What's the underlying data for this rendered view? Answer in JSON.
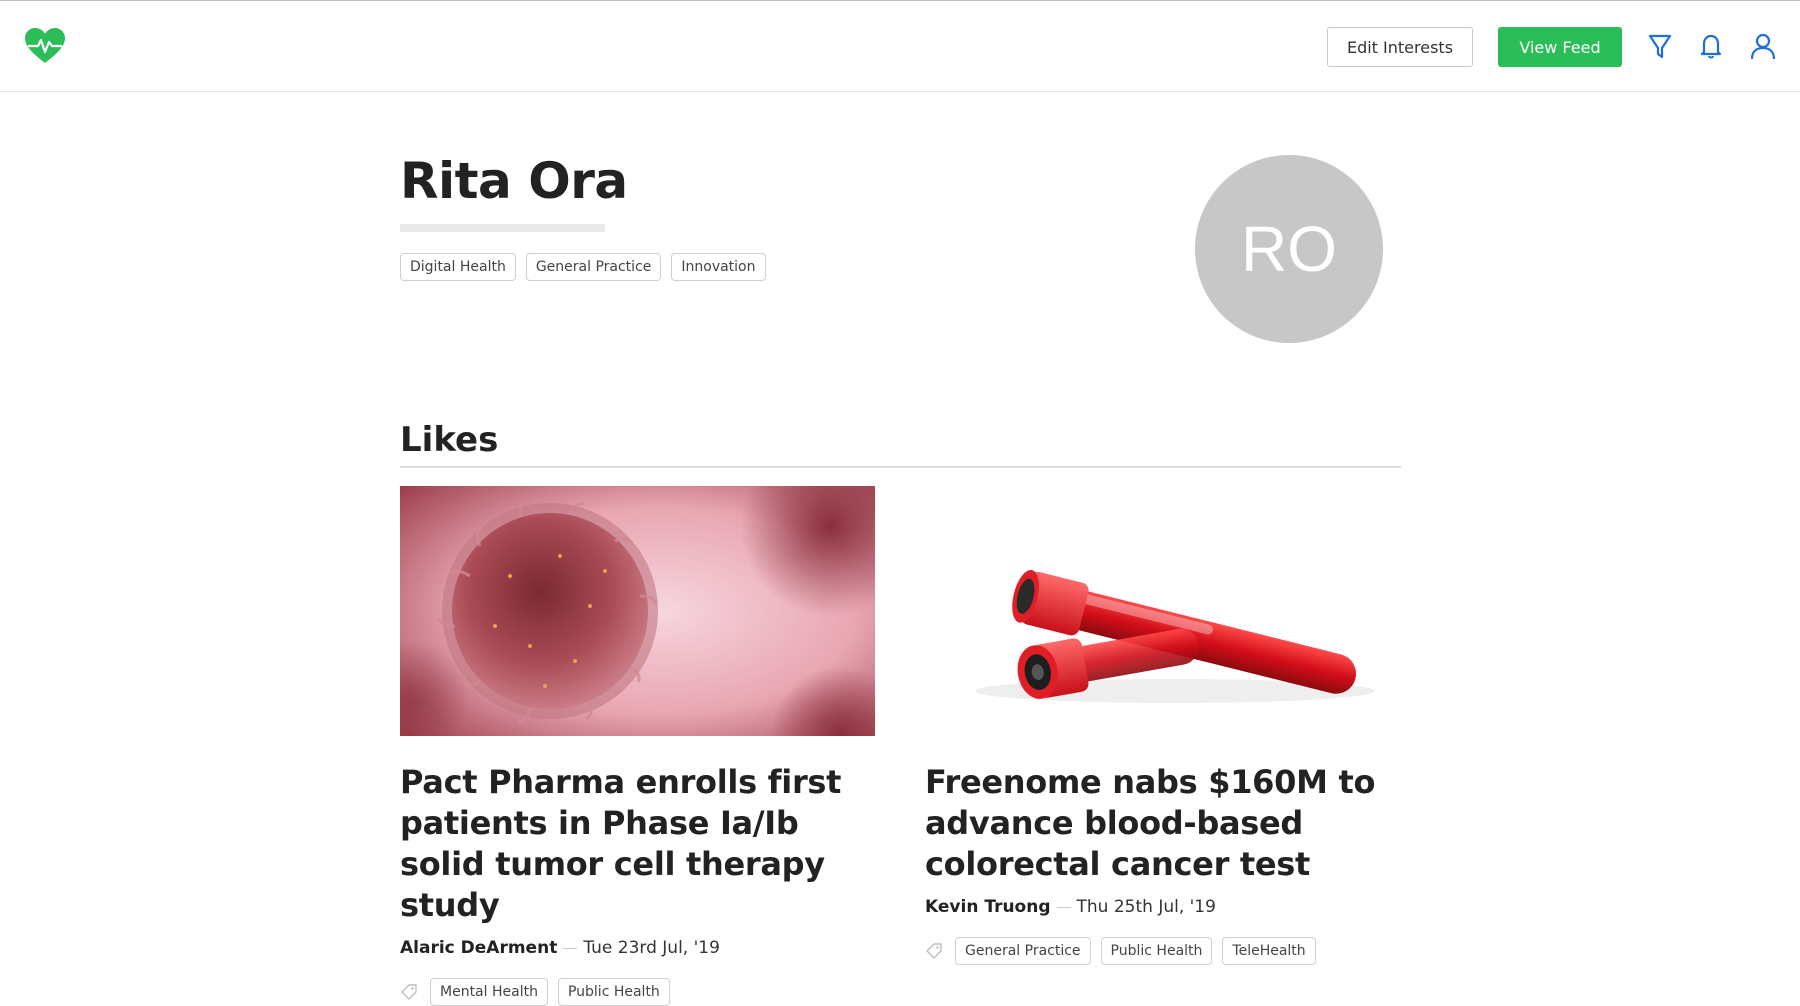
{
  "header": {
    "edit_interests_label": "Edit Interests",
    "view_feed_label": "View Feed",
    "accent_color": "#2bbd57",
    "icons": [
      "heart-pulse-logo-icon",
      "filter-icon",
      "bell-icon",
      "user-icon"
    ]
  },
  "profile": {
    "name": "Rita Ora",
    "initials": "RO",
    "interests": [
      "Digital Health",
      "General Practice",
      "Innovation"
    ]
  },
  "likes": {
    "title": "Likes",
    "articles": [
      {
        "title": "Pact Pharma enrolls first patients in Phase Ia/Ib solid tumor cell therapy study",
        "author": "Alaric DeArment",
        "date": "Tue 23rd Jul, '19",
        "tags": [
          "Mental Health",
          "Public Health"
        ]
      },
      {
        "title": "Freenome nabs $160M to advance blood-based colorectal cancer test",
        "author": "Kevin Truong",
        "date": "Thu 25th Jul, '19",
        "tags": [
          "General Practice",
          "Public Health",
          "TeleHealth"
        ]
      }
    ]
  }
}
